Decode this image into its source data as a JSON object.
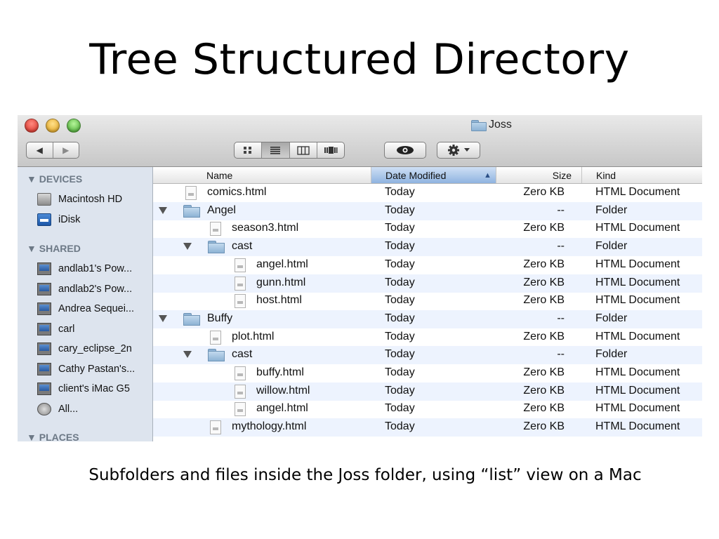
{
  "slide": {
    "title": "Tree Structured Directory",
    "caption": "Subfolders and files inside the Joss folder, using “list” view on a Mac"
  },
  "window": {
    "title": "Joss",
    "toolbar": {
      "back_glyph": "◀",
      "forward_glyph": "▶",
      "views": [
        "icon-view",
        "list-view",
        "column-view",
        "coverflow-view"
      ],
      "selected_view": "list-view",
      "quicklook_icon": "eye-icon",
      "action_icon": "gear-icon"
    }
  },
  "sidebar": {
    "devices_label": "▼ DEVICES",
    "devices": [
      {
        "label": "Macintosh HD",
        "icon": "hard-drive-icon"
      },
      {
        "label": "iDisk",
        "icon": "idisk-icon"
      }
    ],
    "shared_label": "▼ SHARED",
    "shared": [
      {
        "label": "andlab1's Pow...",
        "icon": "monitor-icon"
      },
      {
        "label": "andlab2's Pow...",
        "icon": "monitor-icon"
      },
      {
        "label": "Andrea Sequei...",
        "icon": "monitor-icon"
      },
      {
        "label": "carl",
        "icon": "monitor-icon"
      },
      {
        "label": "cary_eclipse_2n",
        "icon": "monitor-icon"
      },
      {
        "label": "Cathy Pastan's...",
        "icon": "monitor-icon"
      },
      {
        "label": "client's iMac G5",
        "icon": "monitor-icon"
      },
      {
        "label": "All...",
        "icon": "network-icon"
      }
    ],
    "places_label": "▼ PLACES"
  },
  "columns": {
    "name": "Name",
    "date": "Date Modified",
    "date_sort_glyph": "▲",
    "size": "Size",
    "kind": "Kind"
  },
  "rows": [
    {
      "name": "comics.html",
      "type": "file",
      "depth": 0,
      "date": "Today",
      "size": "Zero KB",
      "kind": "HTML Document"
    },
    {
      "name": "Angel",
      "type": "folder",
      "depth": 0,
      "date": "Today",
      "size": "--",
      "kind": "Folder"
    },
    {
      "name": "season3.html",
      "type": "file",
      "depth": 1,
      "date": "Today",
      "size": "Zero KB",
      "kind": "HTML Document"
    },
    {
      "name": "cast",
      "type": "folder",
      "depth": 1,
      "date": "Today",
      "size": "--",
      "kind": "Folder"
    },
    {
      "name": "angel.html",
      "type": "file",
      "depth": 2,
      "date": "Today",
      "size": "Zero KB",
      "kind": "HTML Document"
    },
    {
      "name": "gunn.html",
      "type": "file",
      "depth": 2,
      "date": "Today",
      "size": "Zero KB",
      "kind": "HTML Document"
    },
    {
      "name": "host.html",
      "type": "file",
      "depth": 2,
      "date": "Today",
      "size": "Zero KB",
      "kind": "HTML Document"
    },
    {
      "name": "Buffy",
      "type": "folder",
      "depth": 0,
      "date": "Today",
      "size": "--",
      "kind": "Folder"
    },
    {
      "name": "plot.html",
      "type": "file",
      "depth": 1,
      "date": "Today",
      "size": "Zero KB",
      "kind": "HTML Document"
    },
    {
      "name": "cast",
      "type": "folder",
      "depth": 1,
      "date": "Today",
      "size": "--",
      "kind": "Folder"
    },
    {
      "name": "buffy.html",
      "type": "file",
      "depth": 2,
      "date": "Today",
      "size": "Zero KB",
      "kind": "HTML Document"
    },
    {
      "name": "willow.html",
      "type": "file",
      "depth": 2,
      "date": "Today",
      "size": "Zero KB",
      "kind": "HTML Document"
    },
    {
      "name": "angel.html",
      "type": "file",
      "depth": 2,
      "date": "Today",
      "size": "Zero KB",
      "kind": "HTML Document"
    },
    {
      "name": "mythology.html",
      "type": "file",
      "depth": 1,
      "date": "Today",
      "size": "Zero KB",
      "kind": "HTML Document"
    }
  ]
}
